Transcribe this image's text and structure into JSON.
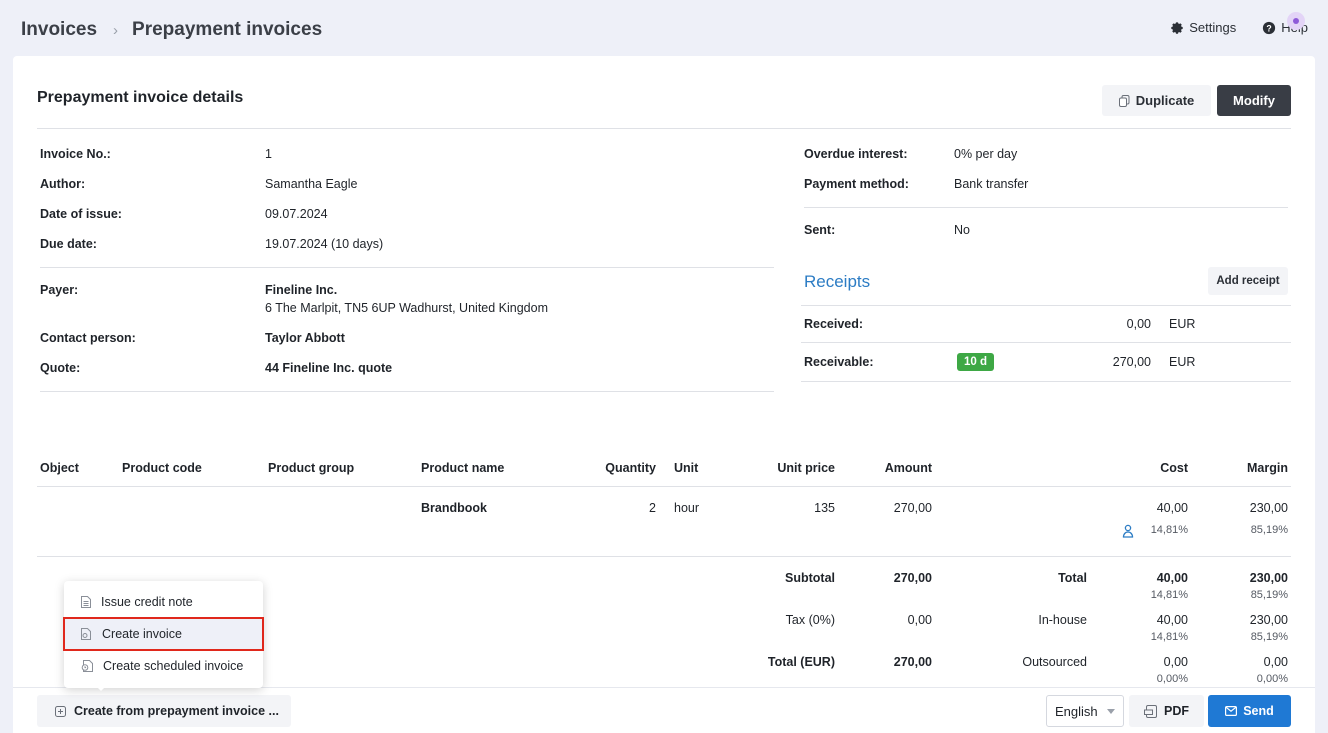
{
  "breadcrumb": {
    "root": "Invoices",
    "current": "Prepayment invoices"
  },
  "top_actions": {
    "settings": "Settings",
    "help": "Help"
  },
  "title": "Prepayment invoice details",
  "buttons": {
    "duplicate": "Duplicate",
    "modify": "Modify"
  },
  "details": {
    "invoice_no": {
      "label": "Invoice No.:",
      "value": "1"
    },
    "author": {
      "label": "Author:",
      "value": "Samantha Eagle"
    },
    "date_of_issue": {
      "label": "Date of issue:",
      "value": "09.07.2024"
    },
    "due_date": {
      "label": "Due date:",
      "value": "19.07.2024 (10 days)"
    },
    "payer": {
      "label": "Payer:",
      "name": "Fineline Inc.",
      "address": "6 The Marlpit, TN5 6UP Wadhurst, United Kingdom"
    },
    "contact_person": {
      "label": "Contact person:",
      "value": "Taylor Abbott"
    },
    "quote": {
      "label": "Quote:",
      "value": "44 Fineline Inc. quote"
    },
    "overdue_interest": {
      "label": "Overdue interest:",
      "value": "0% per day"
    },
    "payment_method": {
      "label": "Payment method:",
      "value": "Bank transfer"
    },
    "sent": {
      "label": "Sent:",
      "value": "No"
    }
  },
  "receipts": {
    "title": "Receipts",
    "add_button": "Add receipt",
    "received": {
      "label": "Received:",
      "amount": "0,00",
      "currency": "EUR"
    },
    "receivable": {
      "label": "Receivable:",
      "badge": "10 d",
      "amount": "270,00",
      "currency": "EUR"
    }
  },
  "table": {
    "columns": [
      "Object",
      "Product code",
      "Product group",
      "Product name",
      "Quantity",
      "Unit",
      "Unit price",
      "Amount",
      "Cost",
      "Margin"
    ],
    "row": {
      "product_name": "Brandbook",
      "quantity": "2",
      "unit": "hour",
      "unit_price": "135",
      "amount": "270,00",
      "cost": "40,00",
      "cost_pct": "14,81%",
      "margin": "230,00",
      "margin_pct": "85,19%"
    }
  },
  "totals": {
    "subtotal": {
      "label": "Subtotal",
      "value": "270,00"
    },
    "tax": {
      "label": "Tax (0%)",
      "value": "0,00"
    },
    "total_eur": {
      "label": "Total (EUR)",
      "value": "270,00"
    },
    "total": {
      "label": "Total",
      "cost": "40,00",
      "cost_pct": "14,81%",
      "margin": "230,00",
      "margin_pct": "85,19%"
    },
    "in_house": {
      "label": "In-house",
      "cost": "40,00",
      "cost_pct": "14,81%",
      "margin": "230,00",
      "margin_pct": "85,19%"
    },
    "outsourced": {
      "label": "Outsourced",
      "cost": "0,00",
      "cost_pct": "0,00%",
      "margin": "0,00",
      "margin_pct": "0,00%"
    }
  },
  "popup_menu": {
    "items": [
      "Issue credit note",
      "Create invoice",
      "Create scheduled invoice"
    ]
  },
  "footer": {
    "create_from": "Create from prepayment invoice ...",
    "language": "English",
    "pdf": "PDF",
    "send": "Send"
  },
  "colors": {
    "accent": "#1f79d4",
    "badge_green": "#3ea845",
    "highlight_red": "#e0281c",
    "dark_button": "#393d45"
  }
}
